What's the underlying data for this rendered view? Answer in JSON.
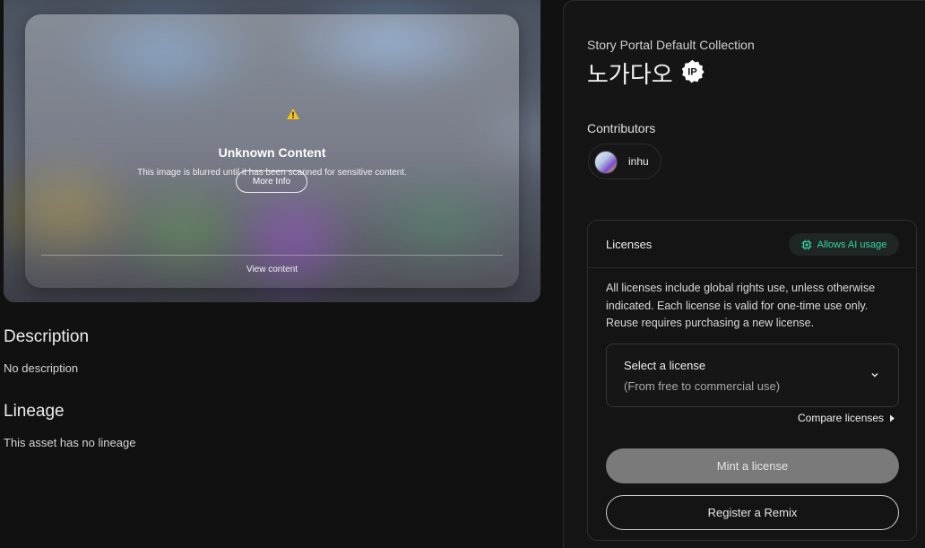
{
  "media": {
    "overlay_title": "Unknown Content",
    "overlay_desc": "This image is blurred until it has been scanned for sensitive content.",
    "more_info_label": "More Info",
    "view_content_label": "View content",
    "warning_icon": "warning-triangle-icon",
    "warning_color": "#f5c518"
  },
  "description": {
    "title": "Description",
    "text": "No description"
  },
  "lineage": {
    "title": "Lineage",
    "text": "This asset has no lineage"
  },
  "asset": {
    "collection": "Story Portal Default Collection",
    "title": "노가다오",
    "ip_badge": "IP"
  },
  "contributors": {
    "label": "Contributors",
    "items": [
      {
        "name": "inhu"
      }
    ]
  },
  "licenses": {
    "title": "Licenses",
    "ai_badge": "Allows AI usage",
    "ai_badge_color": "#35d6a5",
    "description": "All licenses include global rights use, unless otherwise indicated. Each license is valid for one-time use only. Reuse requires purchasing a new license.",
    "select_title": "Select a license",
    "select_subtitle": "(From free to commercial use)",
    "compare_label": "Compare licenses",
    "mint_label": "Mint a license",
    "remix_label": "Register a Remix"
  }
}
